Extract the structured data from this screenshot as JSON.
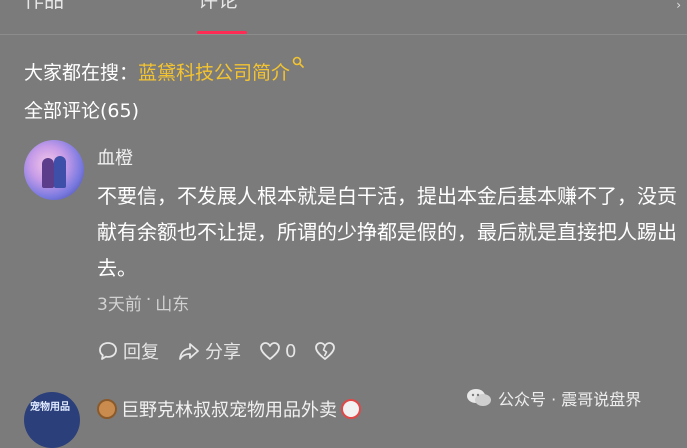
{
  "tabs": [
    {
      "label": "作品"
    },
    {
      "label": "评论"
    }
  ],
  "search_suggestion": {
    "prefix": "大家都在搜：",
    "term": "蓝黛科技公司简介"
  },
  "comments_header": {
    "label": "全部评论(65)"
  },
  "comment": {
    "username": "血橙",
    "text": "不要信，不发展人根本就是白干活，提出本金后基本赚不了，没贡献有余额也不让提，所谓的少挣都是假的，最后就是直接把人踢出去。",
    "time": "3天前",
    "separator": "·",
    "location": "山东",
    "actions": {
      "reply_label": "回复",
      "share_label": "分享",
      "like_count": "0"
    }
  },
  "next_comment": {
    "username": "巨野克林叔叔宠物用品外卖",
    "avatar_text": "宠物用品"
  },
  "watermark": {
    "text": "公众号 · 震哥说盘界"
  },
  "colors": {
    "background": "#7b7b7b",
    "accent": "#fe2c55",
    "highlight": "#f4c430"
  }
}
